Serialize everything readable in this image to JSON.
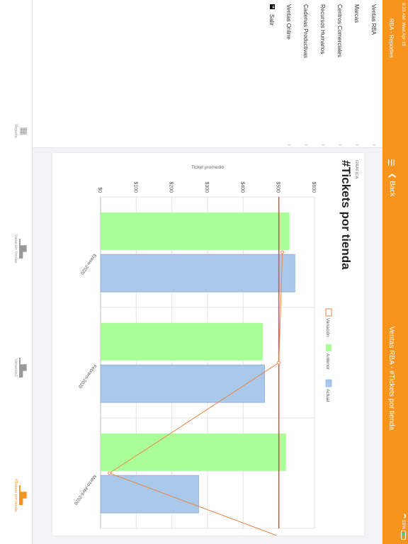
{
  "status_bar": {
    "time": "9:23 AM",
    "date": "Wed Apr 15",
    "battery": "55%"
  },
  "header": {
    "app_title": "RBA - Reportes",
    "back_label": "Back",
    "page_title": "Ventas RBA - #Tickets por tienda"
  },
  "sidebar": {
    "items": [
      {
        "label": "Ventas RBA"
      },
      {
        "label": "Marcas"
      },
      {
        "label": "Centros Comerciales"
      },
      {
        "label": "Recursos Humanos"
      },
      {
        "label": "Cadenas Productivas"
      },
      {
        "label": "Ventas Online"
      }
    ],
    "logout_label": "Salir"
  },
  "card": {
    "section_label": "GRÁFICA",
    "title": "#Tickets por tienda"
  },
  "chart_data": {
    "type": "bar",
    "categories": [
      "Enero-2020",
      "Febrero-2020",
      "Marzo-Abril-2020"
    ],
    "series": [
      {
        "name": "Anterior",
        "type": "bar",
        "color": "#aaff99",
        "values": [
          530,
          455,
          520
        ]
      },
      {
        "name": "Actual",
        "type": "bar",
        "color": "#a9c8ea",
        "values": [
          545,
          460,
          275
        ]
      },
      {
        "name": "Variación",
        "type": "line",
        "color": "#e8874a",
        "values": [
          510,
          500,
          25
        ]
      }
    ],
    "ylabel": "Ticket promedio",
    "ylim": [
      0,
      600
    ],
    "yticks": [
      "$0",
      "$100",
      "$200",
      "$300",
      "$400",
      "$500",
      "$600"
    ],
    "reference_line_value": 500,
    "reference_line_color": "#d9534f",
    "legend_position": "top",
    "grid": true
  },
  "tabbar": {
    "tabs": [
      {
        "label": "Reporte",
        "icon": "grid-icon"
      },
      {
        "label": "Variación Ventas",
        "icon": "bar-chart-icon"
      },
      {
        "label": "Variación2",
        "icon": "bar-chart-icon"
      },
      {
        "label": "#Tickets por tienda",
        "icon": "bar-chart-icon",
        "active": true
      }
    ]
  }
}
